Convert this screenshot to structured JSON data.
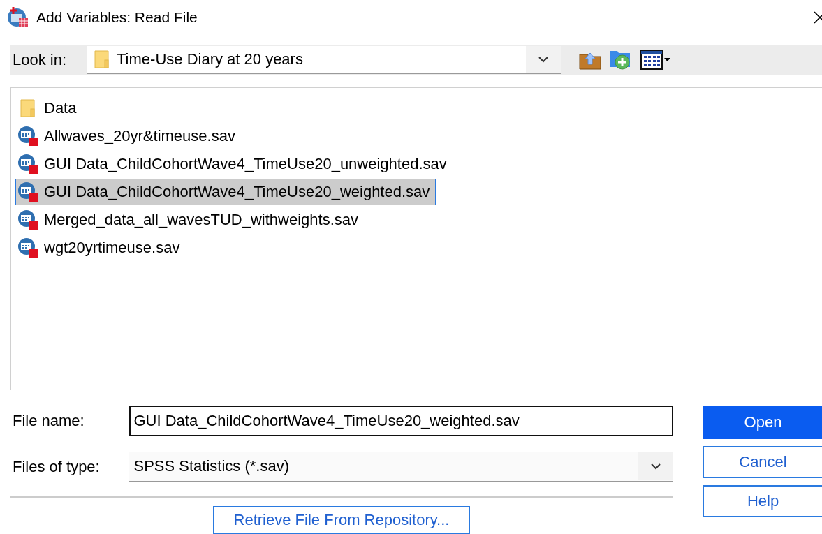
{
  "window": {
    "title": "Add Variables: Read File"
  },
  "look_in": {
    "label": "Look in:",
    "value": "Time-Use Diary at 20 years"
  },
  "files": [
    {
      "name": "Data",
      "kind": "folder",
      "selected": false
    },
    {
      "name": "Allwaves_20yr&timeuse.sav",
      "kind": "sav",
      "selected": false
    },
    {
      "name": "GUI Data_ChildCohortWave4_TimeUse20_unweighted.sav",
      "kind": "sav",
      "selected": false
    },
    {
      "name": "GUI Data_ChildCohortWave4_TimeUse20_weighted.sav",
      "kind": "sav",
      "selected": true
    },
    {
      "name": "Merged_data_all_wavesTUD_withweights.sav",
      "kind": "sav",
      "selected": false
    },
    {
      "name": "wgt20yrtimeuse.sav",
      "kind": "sav",
      "selected": false
    }
  ],
  "file_name": {
    "label": "File name:",
    "value": "GUI Data_ChildCohortWave4_TimeUse20_weighted.sav"
  },
  "file_type": {
    "label": "Files of type:",
    "value": "SPSS Statistics (*.sav)"
  },
  "buttons": [
    {
      "label": "Open",
      "kind": "default"
    },
    {
      "label": "Cancel",
      "kind": "normal"
    },
    {
      "label": "Help",
      "kind": "normal"
    }
  ],
  "repository_button": {
    "label": "Retrieve File From Repository..."
  }
}
